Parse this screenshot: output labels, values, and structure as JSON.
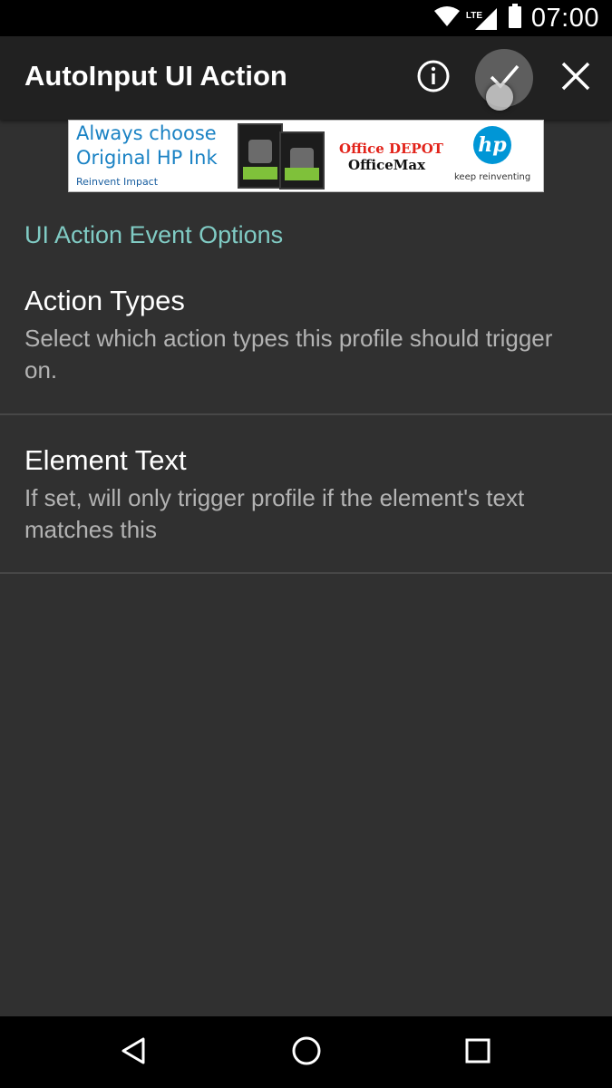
{
  "status_bar": {
    "time": "07:00",
    "network": "LTE",
    "icons": [
      "wifi-icon",
      "cell-signal-icon",
      "battery-icon"
    ]
  },
  "app_bar": {
    "title": "AutoInput UI Action",
    "actions": [
      "info-icon",
      "check-icon",
      "close-icon"
    ]
  },
  "ad": {
    "line1": "Always choose",
    "line2": "Original HP Ink",
    "tagline": "Reinvent Impact",
    "store_line1": "Office DEPOT",
    "store_line2": "OfficeMax",
    "brand": "hp",
    "brand_tagline": "keep reinventing"
  },
  "content": {
    "section_header": "UI Action Event Options",
    "items": [
      {
        "title": "Action Types",
        "summary": "Select which action types this profile should trigger on."
      },
      {
        "title": "Element Text",
        "summary": "If set, will only trigger profile if the element's text matches this"
      }
    ]
  },
  "nav_bar": {
    "buttons": [
      "back-icon",
      "home-icon",
      "recents-icon"
    ]
  },
  "colors": {
    "background": "#303030",
    "app_bar": "#212121",
    "accent": "#80cbc4",
    "primary_text": "#ffffff",
    "secondary_text": "#b3b3b3",
    "divider": "#474747"
  }
}
